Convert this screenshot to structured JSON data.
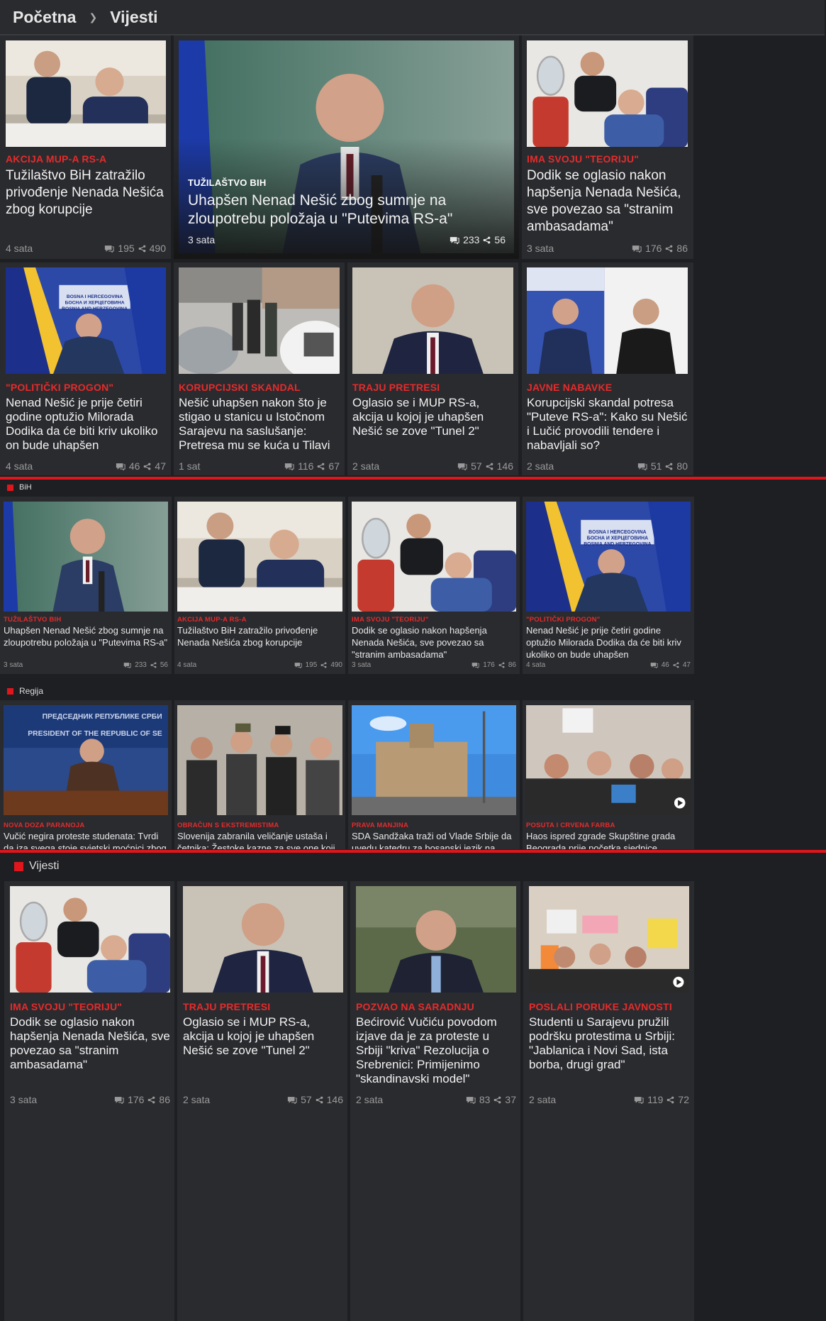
{
  "breadcrumb": {
    "home": "Početna",
    "current": "Vijesti"
  },
  "top_grid": [
    {
      "cat": "AKCIJA MUP-A RS-A",
      "title": "Tužilaštvo BiH zatražilo privođenje Nenada Nešića zbog korupcije",
      "time": "4 sata",
      "comments": "195",
      "shares": "490"
    },
    {
      "cat": "TUŽILAŠTVO BIH",
      "title": "Uhapšen Nenad Nešić zbog sumnje na zloupotrebu položaja u \"Putevima RS-a\"",
      "time": "3 sata",
      "comments": "233",
      "shares": "56"
    },
    {
      "cat": "IMA SVOJU \"TEORIJU\"",
      "title": "Dodik se oglasio nakon hapšenja Nenada Nešića, sve povezao sa \"stranim ambasadama\"",
      "time": "3 sata",
      "comments": "176",
      "shares": "86"
    },
    {
      "cat": "\"POLITIČKI PROGON\"",
      "title": "Nenad Nešić je prije četiri godine optužio Milorada Dodika da će biti kriv ukoliko on bude uhapšen",
      "time": "4 sata",
      "comments": "46",
      "shares": "47"
    },
    {
      "cat": "KORUPCIJSKI SKANDAL",
      "title": "Nešić uhapšen nakon što je stigao u stanicu u Istočnom Sarajevu na saslušanje: Pretresa mu se kuća u Tilavi",
      "time": "1 sat",
      "comments": "116",
      "shares": "67"
    },
    {
      "cat": "TRAJU PRETRESI",
      "title": "Oglasio se i MUP RS-a, akcija u kojoj je uhapšen Nešić se zove \"Tunel 2\"",
      "time": "2 sata",
      "comments": "57",
      "shares": "146"
    },
    {
      "cat": "JAVNE NABAVKE",
      "title": "Korupcijski skandal potresa \"Puteve RS-a\": Kako su Nešić i Lučić provodili tendere i nabavljali so?",
      "time": "2 sata",
      "comments": "51",
      "shares": "80"
    }
  ],
  "section_bih": {
    "label": "BiH",
    "items": [
      {
        "cat": "TUŽILAŠTVO BIH",
        "title": "Uhapšen Nenad Nešić zbog sumnje na zloupotrebu položaja u \"Putevima RS-a\"",
        "time": "3 sata",
        "comments": "233",
        "shares": "56"
      },
      {
        "cat": "AKCIJA MUP-A RS-A",
        "title": "Tužilaštvo BiH zatražilo privođenje Nenada Nešića zbog korupcije",
        "time": "4 sata",
        "comments": "195",
        "shares": "490"
      },
      {
        "cat": "IMA SVOJU \"TEORIJU\"",
        "title": "Dodik se oglasio nakon hapšenja Nenada Nešića, sve povezao sa \"stranim ambasadama\"",
        "time": "3 sata",
        "comments": "176",
        "shares": "86"
      },
      {
        "cat": "\"POLITIČKI PROGON\"",
        "title": "Nenad Nešić je prije četiri godine optužio Milorada Dodika da će biti kriv ukoliko on bude uhapšen",
        "time": "4 sata",
        "comments": "46",
        "shares": "47"
      }
    ]
  },
  "section_regija": {
    "label": "Regija",
    "items": [
      {
        "cat": "NOVA DOZA PARANOJA",
        "title": "Vučić negira proteste studenata: Tvrdi da iza svega stoje svjetski moćnici zbog",
        "sign": "ПРЕДСЕДНИК РЕПУБЛИКЕ СРБИ",
        "sign2": "PRESIDENT OF THE REPUBLIC OF SE"
      },
      {
        "cat": "OBRAČUN S EKSTREMISTIMA",
        "title": "Slovenija zabranila veličanje ustaša i četnika: Žestoke kazne za sve one koji se"
      },
      {
        "cat": "PRAVA MANJINA",
        "title": "SDA Sandžaka traži od Vlade Srbije da uvedu katedru za bosanski jezik na"
      },
      {
        "cat": "POSUTA I CRVENA FARBA",
        "title": "Haos ispred zgrade Skupštine grada Beograda prije početka sjednice, sukobili"
      }
    ]
  },
  "section_vijesti": {
    "label": "Vijesti",
    "items": [
      {
        "cat": "IMA SVOJU \"TEORIJU\"",
        "title": "Dodik se oglasio nakon hapšenja Nenada Nešića, sve povezao sa \"stranim ambasadama\"",
        "time": "3 sata",
        "comments": "176",
        "shares": "86"
      },
      {
        "cat": "TRAJU PRETRESI",
        "title": "Oglasio se i MUP RS-a, akcija u kojoj je uhapšen Nešić se zove \"Tunel 2\"",
        "time": "2 sata",
        "comments": "57",
        "shares": "146"
      },
      {
        "cat": "POZVAO NA SARADNJU",
        "title": "Bećirović Vučiću povodom izjave da je za proteste u Srbiji \"kriva\" Rezolucija o Srebrenici: Primijenimo \"skandinavski model\"",
        "time": "2 sata",
        "comments": "83",
        "shares": "37"
      },
      {
        "cat": "POSLALI PORUKE JAVNOSTI",
        "title": "Studenti u Sarajevu pružili podršku protestima u Srbiji: \"Jablanica i Novi Sad, ista borba, drugi grad\"",
        "time": "2 sata",
        "comments": "119",
        "shares": "72"
      }
    ]
  },
  "image_texts": {
    "flag_banner_1": "BOSNA I HERCEGOVINA",
    "flag_banner_2": "БОСНА И ХЕРЦЕГОВИНА",
    "flag_banner_3": "BOSNIA AND HERZEGOVINA"
  },
  "colors": {
    "accent": "#e1161c",
    "category": "#e62b2b",
    "card_bg": "#2a2b2f",
    "page_bg": "#1e1f23"
  }
}
